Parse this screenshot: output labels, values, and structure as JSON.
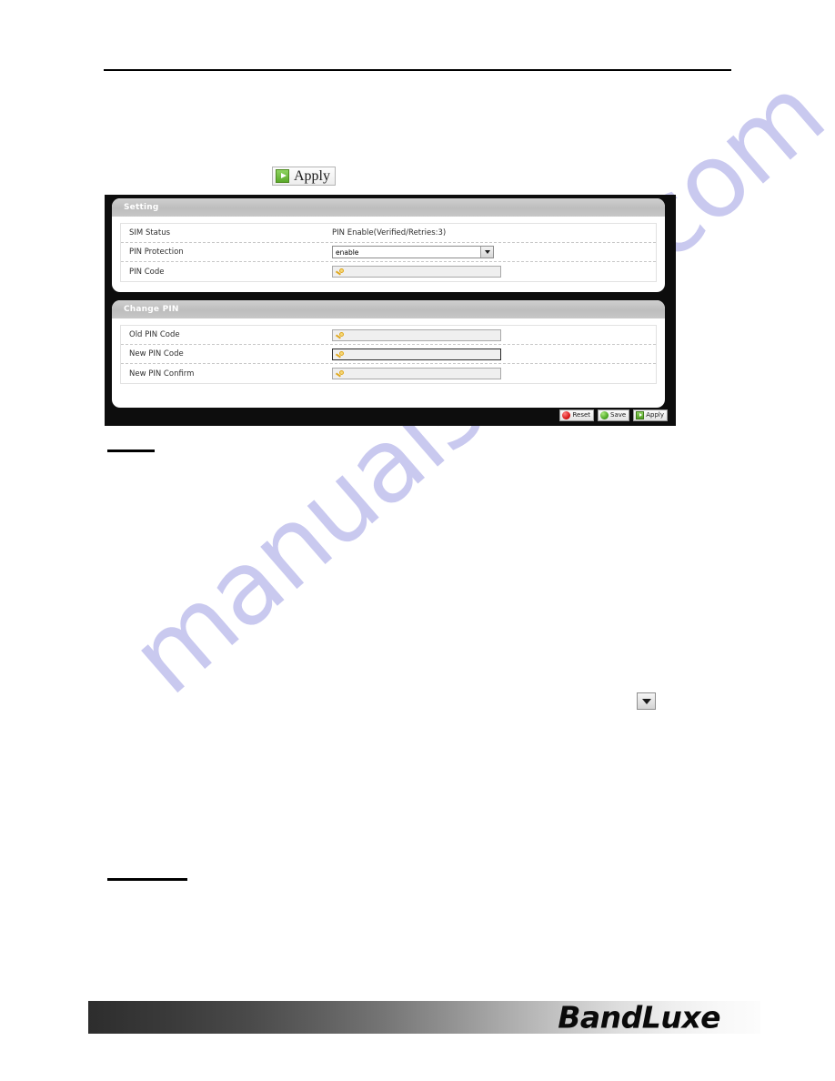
{
  "page": {
    "header_rule": "",
    "watermark_text": "manualshive.com"
  },
  "top_action": {
    "apply_label": "Apply",
    "icon": "apply-green-play-icon"
  },
  "console": {
    "cards": [
      {
        "title": "Setting",
        "rows": [
          {
            "label": "SIM Status",
            "type": "text",
            "value": "PIN Enable(Verified/Retries:3)"
          },
          {
            "label": "PIN Protection",
            "type": "select",
            "value": "enable",
            "icon": "chevron-down-icon"
          },
          {
            "label": "PIN Code",
            "type": "password",
            "value": "",
            "icon": "key-icon"
          }
        ]
      },
      {
        "title": "Change PIN",
        "rows": [
          {
            "label": "Old PIN Code",
            "type": "password",
            "value": "",
            "icon": "key-icon"
          },
          {
            "label": "New PIN Code",
            "type": "password",
            "value": "",
            "icon": "key-icon"
          },
          {
            "label": "New PIN Confirm",
            "type": "password",
            "value": "",
            "icon": "key-icon"
          }
        ]
      }
    ],
    "actions": [
      {
        "label": "Reset",
        "icon": "reset-red-icon",
        "color": "#d61414"
      },
      {
        "label": "Save",
        "icon": "save-green-icon",
        "color": "#49a520"
      },
      {
        "label": "Apply",
        "icon": "apply-green-play-icon",
        "color": "#53a026"
      }
    ]
  },
  "standalone_control": {
    "icon": "chevron-down-icon"
  },
  "footer": {
    "logo_text": "BandLuxe"
  }
}
